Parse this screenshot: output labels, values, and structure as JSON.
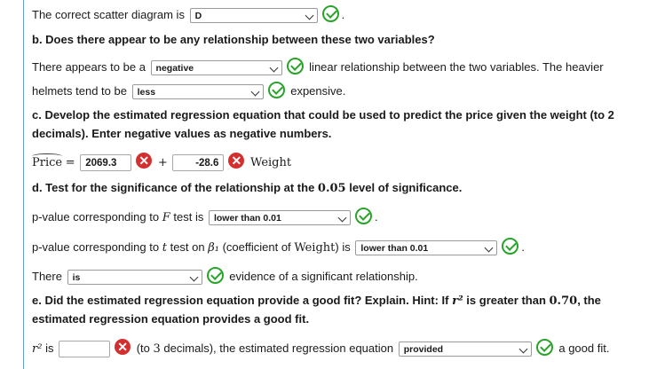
{
  "scatter": {
    "prefix": "The correct scatter diagram is",
    "value": "D"
  },
  "b": {
    "question": "b. Does there appear to be any relationship between these two variables?",
    "s1_prefix": "There appears to be a",
    "s1_value": "negative",
    "s1_suffix": "linear relationship between the two variables. The heavier",
    "s2_prefix": "helmets tend to be",
    "s2_value": "less",
    "s2_suffix": "expensive."
  },
  "c": {
    "question_l1": "c. Develop the estimated regression equation that could be used to predict the price given the weight (to 2",
    "question_l2": "decimals). Enter negative values as negative numbers.",
    "lhs": "Price",
    "eq": "=",
    "intercept": "2069.3",
    "plus": "+",
    "slope": "-28.6",
    "var": "Weight"
  },
  "d": {
    "question_pre": "d. Test for the significance of the relationship at the",
    "alpha": "0.05",
    "question_post": "level of significance.",
    "f_pre": "p-value corresponding to",
    "f_var": "F",
    "f_post": "test is",
    "f_value": "lower than 0.01",
    "t_pre": "p-value corresponding to",
    "t_var": "t",
    "t_mid": "test on",
    "t_beta": "β₁",
    "t_paren_pre": "(coefficient of",
    "t_paren_var": "Weight",
    "t_paren_post": ") is",
    "t_value": "lower than 0.01",
    "there_prefix": "There",
    "there_value": "is",
    "there_suffix": "evidence of a significant relationship."
  },
  "e": {
    "question_l1_pre": "e. Did the estimated regression equation provide a good fit? Explain. Hint: If",
    "r2": "r²",
    "question_l1_mid": "is greater than",
    "threshold": "0.70",
    "question_l1_post": ", the",
    "question_l2": "estimated regression equation provides a good fit.",
    "r2_label": "r²",
    "r2_is": "is",
    "r2_value": "",
    "dec_pre": "(to",
    "dec_n": "3",
    "dec_post": "decimals), the estimated regression equation",
    "fit_value": "provided",
    "fit_suffix": "a good fit."
  },
  "colors": {
    "correct": "#2aa32a",
    "incorrect": "#d32f2f",
    "frame": "#6b9bd6"
  }
}
